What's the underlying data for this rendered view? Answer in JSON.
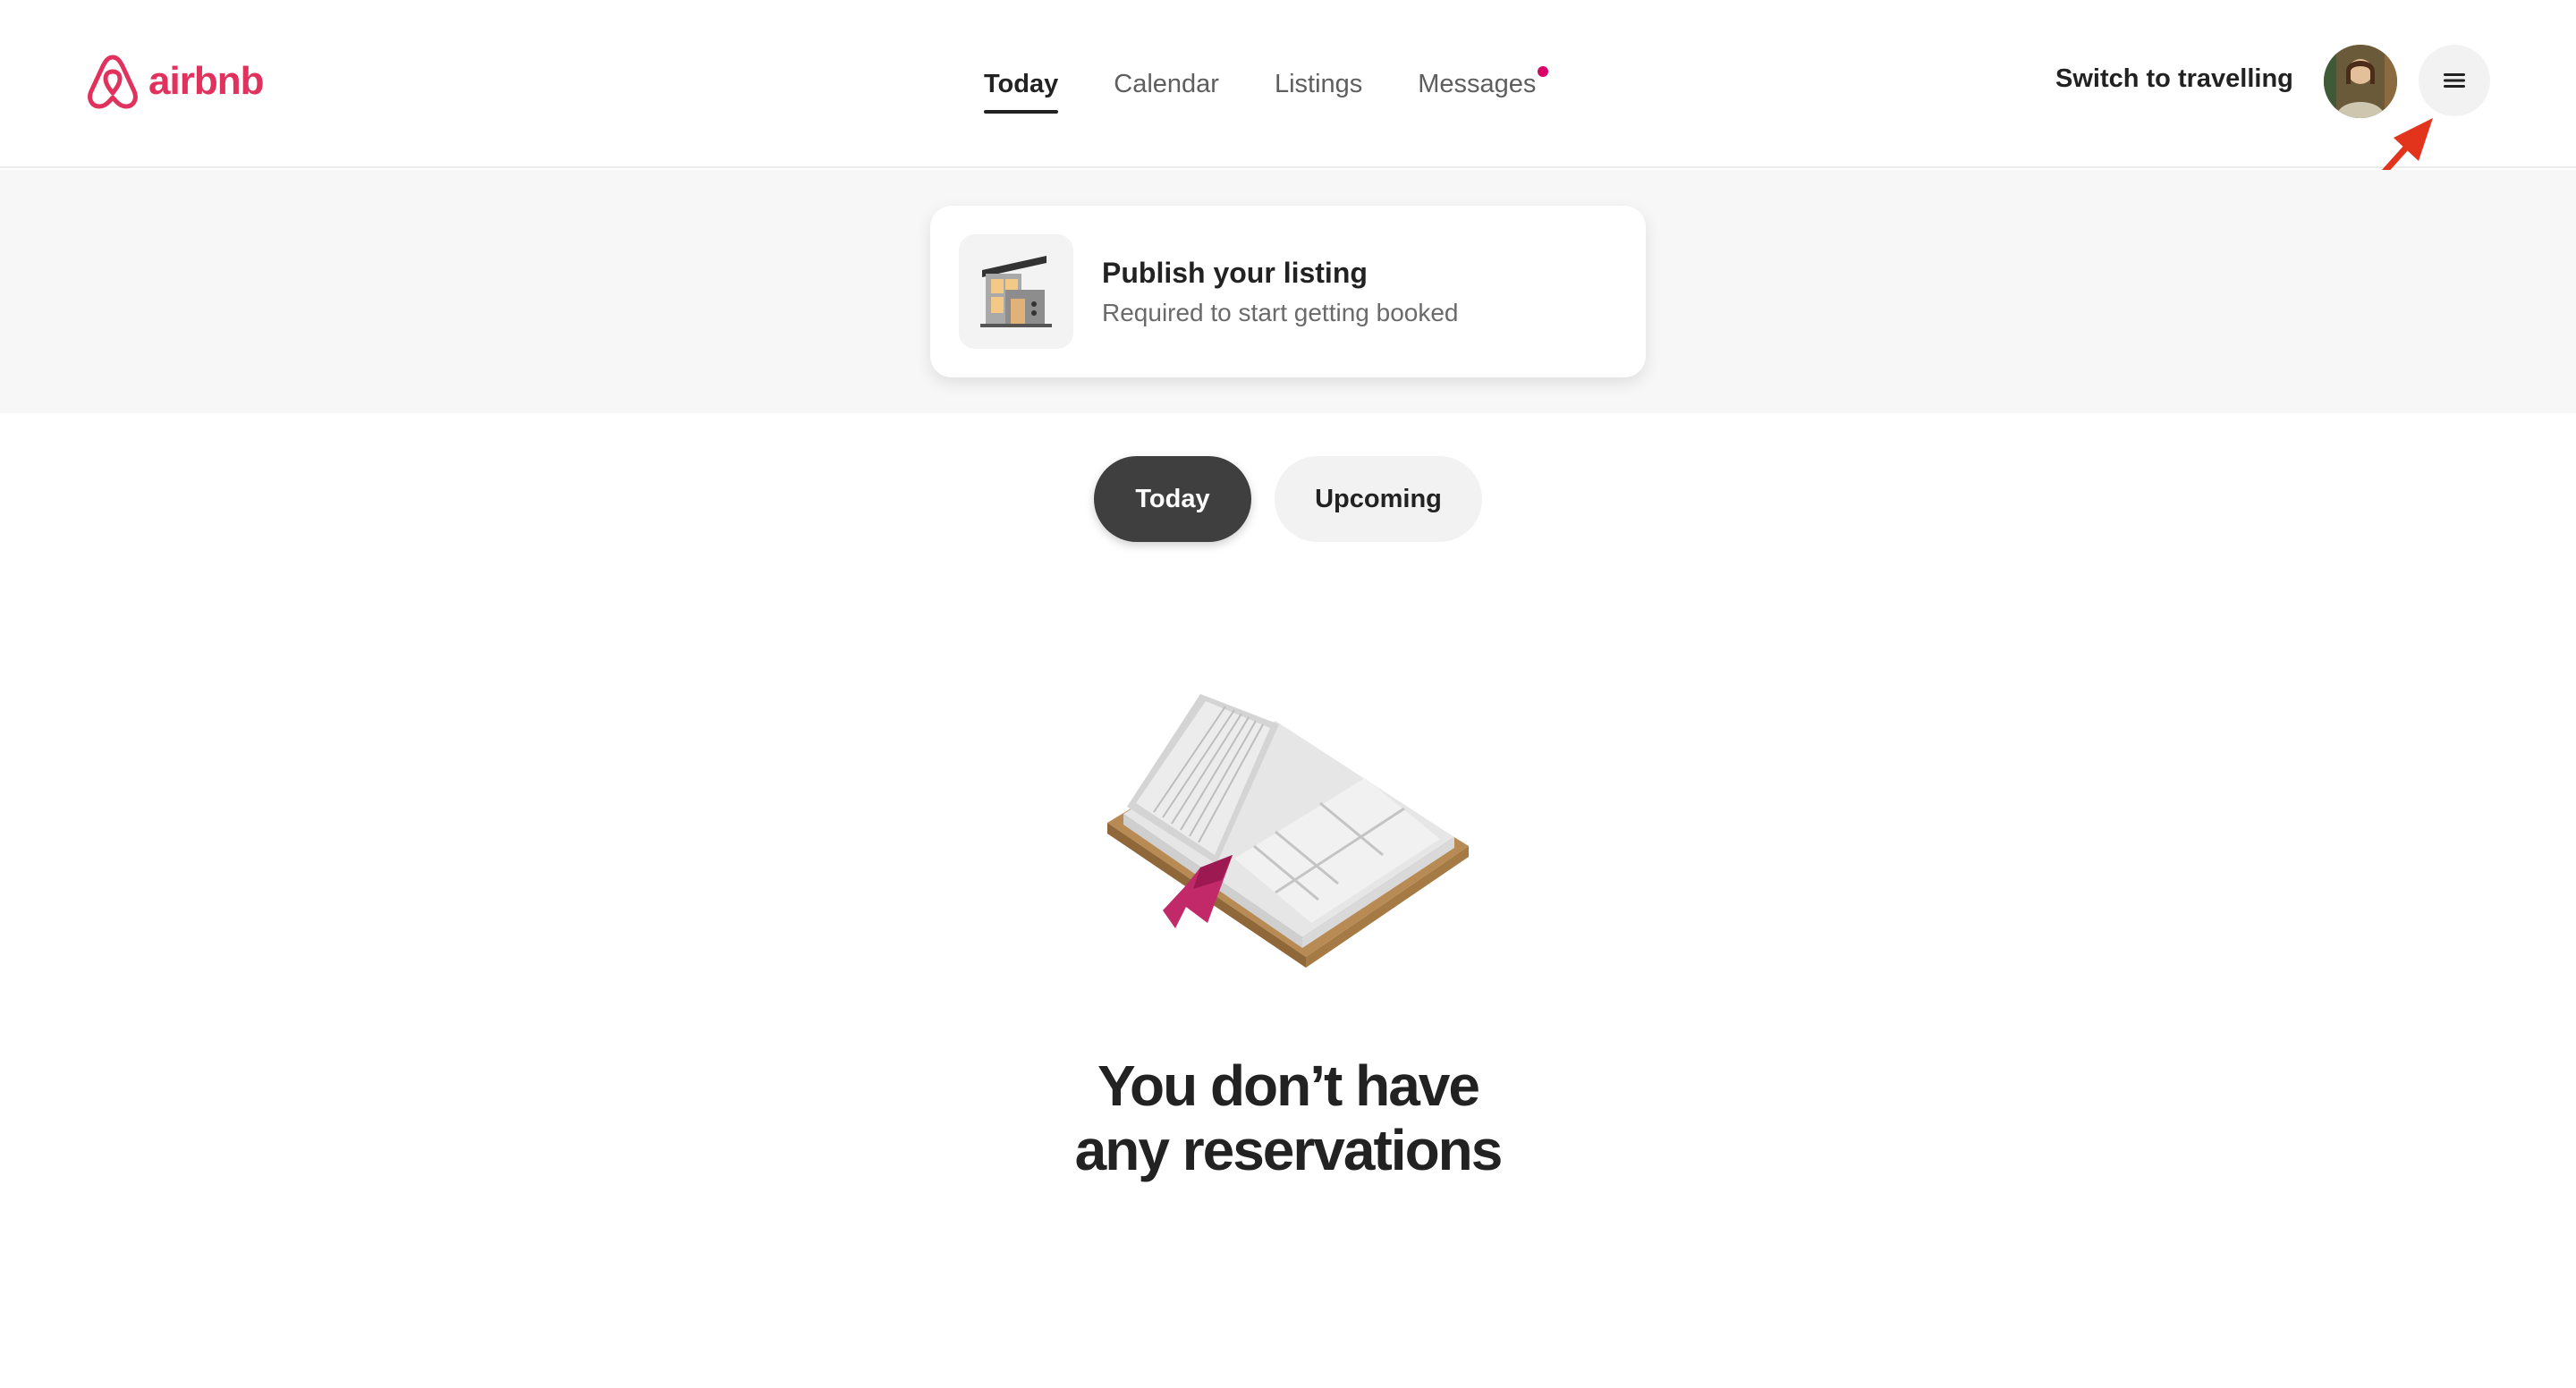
{
  "brand": {
    "name": "airbnb",
    "color": "#E0325C"
  },
  "nav": {
    "items": [
      {
        "label": "Today",
        "active": true
      },
      {
        "label": "Calendar",
        "active": false
      },
      {
        "label": "Listings",
        "active": false
      },
      {
        "label": "Messages",
        "active": false,
        "has_unread_dot": true
      }
    ]
  },
  "header": {
    "switch_label": "Switch to travelling",
    "avatar_icon": "user-avatar",
    "menu_icon": "hamburger-menu-icon"
  },
  "publish_card": {
    "title": "Publish your listing",
    "subtitle": "Required to start getting booked",
    "icon": "house-icon"
  },
  "tabs": [
    {
      "label": "Today",
      "active": true
    },
    {
      "label": "Upcoming",
      "active": false
    }
  ],
  "empty_state": {
    "line1": "You don’t have",
    "line2": "any reservations",
    "illustration": "open-book-icon"
  },
  "colors": {
    "accent": "#E0325C",
    "notification_dot": "#D70466",
    "annotation_arrow": "#E2341D",
    "active_tab_bg": "#3f3f3f"
  }
}
